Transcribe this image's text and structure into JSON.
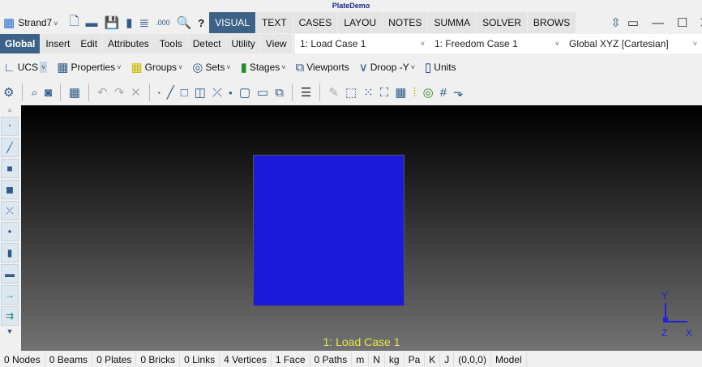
{
  "window": {
    "title": "PlateDemo",
    "app_menu": "Strand7"
  },
  "tabs": [
    "VISUAL",
    "TEXT",
    "CASES",
    "LAYOU",
    "NOTES",
    "SUMMA",
    "SOLVER",
    "BROWS"
  ],
  "active_tab": "VISUAL",
  "menus": [
    "Global",
    "Insert",
    "Edit",
    "Attributes",
    "Tools",
    "Detect",
    "Utility",
    "View"
  ],
  "dropdowns": {
    "load_case": "1: Load Case 1",
    "freedom_case": "1: Freedom Case 1",
    "ucs": "Global XYZ [Cartesian]"
  },
  "toolbar": {
    "ucs": "UCS",
    "properties": "Properties",
    "groups": "Groups",
    "sets": "Sets",
    "stages": "Stages",
    "viewports": "Viewports",
    "droop": "Droop -Y",
    "units": "Units"
  },
  "viewport": {
    "label": "1: Load Case 1",
    "axis_y": "Y",
    "axis_z": "Z",
    "axis_x": "X",
    "plate_color": "#1a1ad8",
    "label_color": "#e6e64a"
  },
  "status": [
    "0 Nodes",
    "0 Beams",
    "0 Plates",
    "0 Bricks",
    "0 Links",
    "4 Vertices",
    "1 Face",
    "0 Paths",
    "m",
    "N",
    "kg",
    "Pa",
    "K",
    "J",
    "(0,0,0)",
    "Model"
  ],
  "colors": {
    "accent": "#3d6288"
  }
}
